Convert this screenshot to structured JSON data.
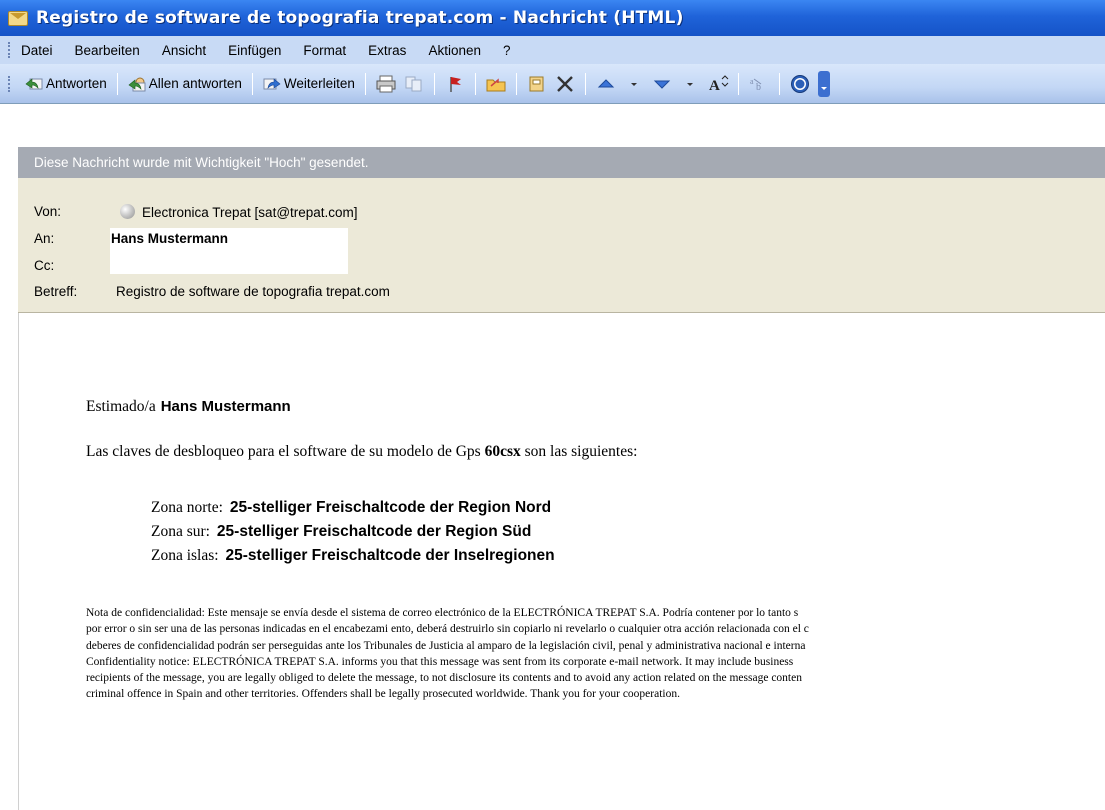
{
  "window": {
    "title": "Registro de software de topografia trepat.com - Nachricht (HTML)"
  },
  "menu": {
    "items": [
      "Datei",
      "Bearbeiten",
      "Ansicht",
      "Einfügen",
      "Format",
      "Extras",
      "Aktionen",
      "?"
    ]
  },
  "toolbar": {
    "reply_label": "Antworten",
    "reply_all_label": "Allen antworten",
    "forward_label": "Weiterleiten",
    "icons": [
      "print-icon",
      "copy-icon",
      "flag-icon",
      "move-to-folder-icon",
      "address-book-icon",
      "delete-icon",
      "previous-item-icon",
      "next-item-icon",
      "font-size-icon",
      "encoding-icon",
      "help-icon"
    ]
  },
  "infobar": {
    "text": "Diese Nachricht wurde mit Wichtigkeit \"Hoch\" gesendet."
  },
  "header": {
    "from_label": "Von:",
    "from_value": "Electronica Trepat [sat@trepat.com]",
    "to_label": "An:",
    "to_value": "Hans Mustermann",
    "cc_label": "Cc:",
    "cc_value": "",
    "subject_label": "Betreff:",
    "subject_value": "Registro de software de topografia trepat.com"
  },
  "message": {
    "greeting_prefix": "Estimado/a",
    "greeting_name": "Hans Mustermann",
    "intro_before": "Las claves de desbloqueo para el software de su modelo de Gps ",
    "intro_model": "60csx",
    "intro_after": " son las siguientes:",
    "zones": [
      {
        "label": "Zona norte:",
        "code": "25-stelliger Freischaltcode der Region Nord"
      },
      {
        "label": "Zona sur:",
        "code": "25-stelliger Freischaltcode der Region Süd"
      },
      {
        "label": "Zona islas:",
        "code": "25-stelliger Freischaltcode der Inselregionen"
      }
    ],
    "notice_lines": [
      "Nota de confidencialidad: Este mensaje se envía desde el sistema de correo electrónico de la ELECTRÓNICA TREPAT S.A. Podría contener por lo tanto s",
      "por error o sin ser una de las personas indicadas en el encabezami ento, deberá destruirlo sin copiarlo ni revelarlo o cualquier otra acción relacionada con el c",
      "deberes de confidencialidad podrán ser perseguidas ante los Tribunales de Justicia al amparo de la legislación civil, penal y administrativa nacional e interna",
      "Confidentiality notice: ELECTRÓNICA TREPAT S.A. informs you that this message was sent from its corporate e-mail network. It may include business",
      "recipients of the message, you are legally obliged to delete the message, to not disclosure its contents and to avoid any action related on the message conten",
      "criminal offence in Spain and other territories. Offenders shall be legally prosecuted worldwide. Thank you for your cooperation."
    ]
  }
}
